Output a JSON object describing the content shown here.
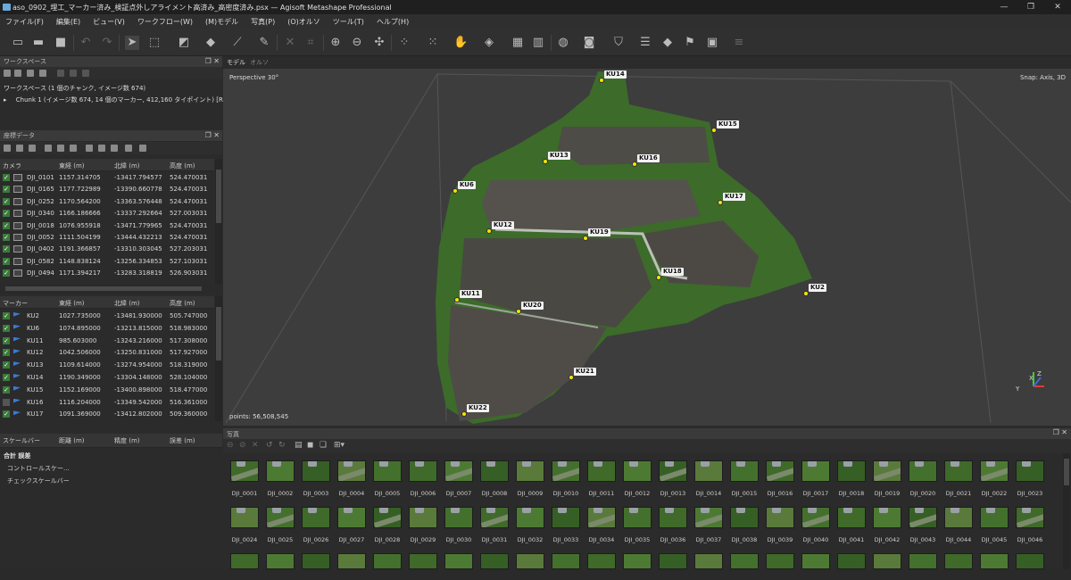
{
  "window": {
    "title": "aso_0902_埋工_マーカー済み_検証点外しアライメント高済み_高密度済み.psx — Agisoft Metashape Professional",
    "minimize": "—",
    "restore": "❐",
    "close": "✕"
  },
  "menu": [
    "ファイル(F)",
    "編集(E)",
    "ビュー(V)",
    "ワークフロー(W)",
    "(M)モデル",
    "写真(P)",
    "(O)オルソ",
    "ツール(T)",
    "ヘルプ(H)"
  ],
  "workspace": {
    "title": "ワークスペース",
    "root": "ワークスペース (1 個のチャンク, イメージ数 674)",
    "chunk": "Chunk 1 (イメージ数 674, 14 個のマーカー, 412,160 タイポイント) [R]"
  },
  "reference": {
    "title": "座標データ",
    "camera_headers": [
      "カメラ",
      "東経 (m)",
      "北緯 (m)",
      "高度 (m)"
    ],
    "cameras": [
      {
        "name": "DJI_0101",
        "e": "1157.314705",
        "n": "-13417.794577",
        "h": "524.470031"
      },
      {
        "name": "DJI_0165",
        "e": "1177.722989",
        "n": "-13390.660778",
        "h": "524.470031"
      },
      {
        "name": "DJI_0252",
        "e": "1170.564200",
        "n": "-13363.576448",
        "h": "524.470031"
      },
      {
        "name": "DJI_0340",
        "e": "1166.186666",
        "n": "-13337.292664",
        "h": "527.003031"
      },
      {
        "name": "DJI_0018",
        "e": "1076.955918",
        "n": "-13471.779965",
        "h": "524.470031"
      },
      {
        "name": "DJI_0052",
        "e": "1111.504199",
        "n": "-13444.432213",
        "h": "524.470031"
      },
      {
        "name": "DJI_0402",
        "e": "1191.366857",
        "n": "-13310.303045",
        "h": "527.203031"
      },
      {
        "name": "DJI_0582",
        "e": "1148.838124",
        "n": "-13256.334853",
        "h": "527.103031"
      },
      {
        "name": "DJI_0494",
        "e": "1171.394217",
        "n": "-13283.318819",
        "h": "526.903031"
      }
    ],
    "marker_headers": [
      "マーカー",
      "東経 (m)",
      "北緯 (m)",
      "高度 (m)"
    ],
    "markers": [
      {
        "name": "KU2",
        "e": "1027.735000",
        "n": "-13481.930000",
        "h": "505.747000",
        "checked": true
      },
      {
        "name": "KU6",
        "e": "1074.895000",
        "n": "-13213.815000",
        "h": "518.983000",
        "checked": true
      },
      {
        "name": "KU11",
        "e": "985.603000",
        "n": "-13243.216000",
        "h": "517.308000",
        "checked": true
      },
      {
        "name": "KU12",
        "e": "1042.506000",
        "n": "-13250.831000",
        "h": "517.927000",
        "checked": true
      },
      {
        "name": "KU13",
        "e": "1109.614000",
        "n": "-13274.954000",
        "h": "518.319000",
        "checked": true
      },
      {
        "name": "KU14",
        "e": "1190.349000",
        "n": "-13304.148000",
        "h": "528.104000",
        "checked": true
      },
      {
        "name": "KU15",
        "e": "1152.169000",
        "n": "-13400.898000",
        "h": "518.477000",
        "checked": true
      },
      {
        "name": "KU16",
        "e": "1116.204000",
        "n": "-13349.542000",
        "h": "516.361000",
        "checked": false
      },
      {
        "name": "KU17",
        "e": "1091.369000",
        "n": "-13412.802000",
        "h": "509.360000",
        "checked": true
      }
    ],
    "scalebar_headers": [
      "スケールバー",
      "距離 (m)",
      "精度 (m)",
      "誤差 (m)"
    ],
    "totals": "合計 誤差",
    "control_scalebars": "コントロールスケー...",
    "check_scalebars": "チェックスケールバー"
  },
  "view": {
    "tab_model": "モデル",
    "tab_ortho": "オルソ",
    "perspective": "Perspective 30°",
    "snap": "Snap: Axis, 3D",
    "points": "points: 56,508,545",
    "markers": [
      "KU14",
      "KU15",
      "KU13",
      "KU16",
      "KU6",
      "KU17",
      "KU12",
      "KU19",
      "KU18",
      "KU2",
      "KU11",
      "KU20",
      "KU21",
      "KU22"
    ],
    "axes": [
      "Y",
      "X",
      "Z"
    ]
  },
  "photos": {
    "title": "写真",
    "names": [
      "DJI_0001",
      "DJI_0002",
      "DJI_0003",
      "DJI_0004",
      "DJI_0005",
      "DJI_0006",
      "DJI_0007",
      "DJI_0008",
      "DJI_0009",
      "DJI_0010",
      "DJI_0011",
      "DJI_0012",
      "DJI_0013",
      "DJI_0014",
      "DJI_0015",
      "DJI_0016",
      "DJI_0017",
      "DJI_0018",
      "DJI_0019",
      "DJI_0020",
      "DJI_0021",
      "DJI_0022",
      "DJI_0023",
      "DJI_0024",
      "DJI_0025",
      "DJI_0026",
      "DJI_0027",
      "DJI_0028",
      "DJI_0029",
      "DJI_0030",
      "DJI_0031",
      "DJI_0032",
      "DJI_0033",
      "DJI_0034",
      "DJI_0035",
      "DJI_0036",
      "DJI_0037",
      "DJI_0038",
      "DJI_0039",
      "DJI_0040",
      "DJI_0041",
      "DJI_0042",
      "DJI_0043",
      "DJI_0044",
      "DJI_0045",
      "DJI_0046"
    ]
  },
  "colors": {
    "marker_flag": "#3a7bd5",
    "marker_dot": "#f3e500",
    "check_green": "#3a7a3a"
  }
}
